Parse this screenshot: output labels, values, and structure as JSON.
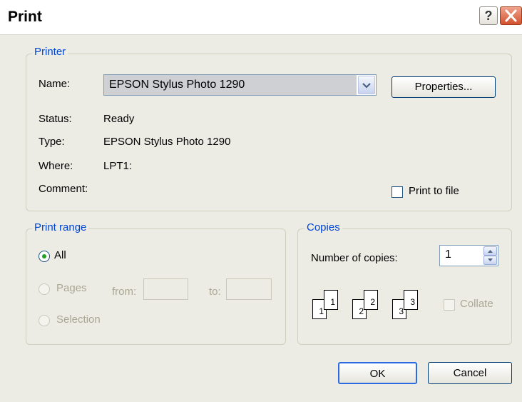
{
  "window": {
    "title": "Print",
    "help_glyph": "?"
  },
  "printer_group": {
    "legend": "Printer",
    "name_label": "Name:",
    "name_value": "EPSON Stylus Photo 1290",
    "properties_button": "Properties...",
    "status_label": "Status:",
    "status_value": "Ready",
    "type_label": "Type:",
    "type_value": "EPSON Stylus Photo 1290",
    "where_label": "Where:",
    "where_value": "LPT1:",
    "comment_label": "Comment:",
    "comment_value": "",
    "print_to_file_label": "Print to file",
    "print_to_file_checked": false
  },
  "range_group": {
    "legend": "Print range",
    "all_label": "All",
    "pages_label": "Pages",
    "from_label": "from:",
    "to_label": "to:",
    "selection_label": "Selection",
    "selected": "All"
  },
  "copies_group": {
    "legend": "Copies",
    "number_label": "Number of copies:",
    "number_value": "1",
    "collate_label": "Collate",
    "collate_checked": false,
    "page_labels": [
      "1",
      "1",
      "2",
      "2",
      "3",
      "3"
    ]
  },
  "actions": {
    "ok": "OK",
    "cancel": "Cancel"
  },
  "colors": {
    "dialog_bg": "#ecebe4",
    "legend": "#0046d5",
    "disabled_text": "#a9a894"
  }
}
